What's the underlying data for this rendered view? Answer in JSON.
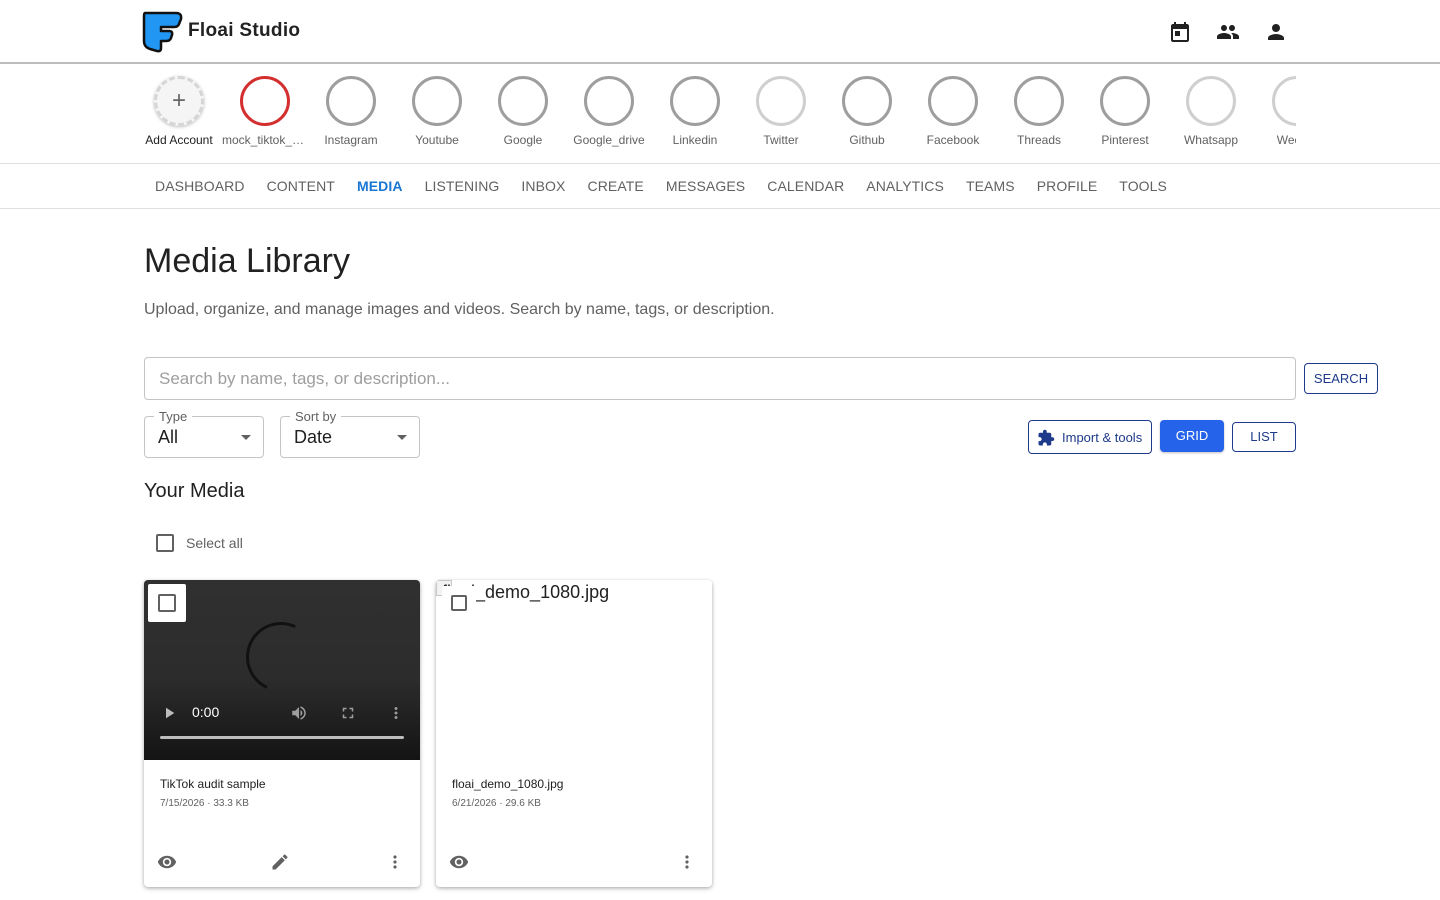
{
  "app": {
    "title": "Floai Studio"
  },
  "header_icons": [
    "calendar-icon",
    "group-icon",
    "person-icon"
  ],
  "accounts": [
    {
      "label": "Add Account",
      "kind": "add"
    },
    {
      "label": "mock_tiktok_user",
      "kind": "red"
    },
    {
      "label": "Instagram",
      "kind": "normal"
    },
    {
      "label": "Youtube",
      "kind": "normal"
    },
    {
      "label": "Google",
      "kind": "normal"
    },
    {
      "label": "Google_drive",
      "kind": "normal"
    },
    {
      "label": "Linkedin",
      "kind": "normal"
    },
    {
      "label": "Twitter",
      "kind": "light"
    },
    {
      "label": "Github",
      "kind": "normal"
    },
    {
      "label": "Facebook",
      "kind": "normal"
    },
    {
      "label": "Threads",
      "kind": "normal"
    },
    {
      "label": "Pinterest",
      "kind": "normal"
    },
    {
      "label": "Whatsapp",
      "kind": "light"
    },
    {
      "label": "Wechat",
      "kind": "light"
    }
  ],
  "nav": {
    "tabs": [
      "Dashboard",
      "Content",
      "Media",
      "Listening",
      "Inbox",
      "Create",
      "Messages",
      "Calendar",
      "Analytics",
      "Teams",
      "Profile",
      "Tools"
    ],
    "active": "Media"
  },
  "page": {
    "title": "Media Library",
    "subtitle": "Upload, organize, and manage images and videos. Search by name, tags, or description."
  },
  "search": {
    "placeholder": "Search by name, tags, or description...",
    "value": "",
    "button": "SEARCH"
  },
  "filters": {
    "type": {
      "label": "Type",
      "value": "All"
    },
    "sort": {
      "label": "Sort by",
      "value": "Date"
    }
  },
  "toolbar": {
    "import_label": "Import & tools",
    "grid_label": "GRID",
    "list_label": "LIST",
    "view": "grid"
  },
  "media": {
    "section_title": "Your Media",
    "select_all_label": "Select all",
    "items": [
      {
        "title": "TikTok audit sample",
        "meta": "7/15/2026 · 33.3 KB",
        "kind": "video",
        "time": "0:00"
      },
      {
        "title": "floai_demo_1080.jpg",
        "meta": "6/21/2026 · 29.6 KB",
        "kind": "image",
        "alt": "floai_demo_1080.jpg"
      }
    ]
  },
  "colors": {
    "accent": "#1976d2",
    "primary_button": "#2563eb",
    "outline": "#1e3a8a",
    "tiktok_ring": "#d32f2f"
  }
}
